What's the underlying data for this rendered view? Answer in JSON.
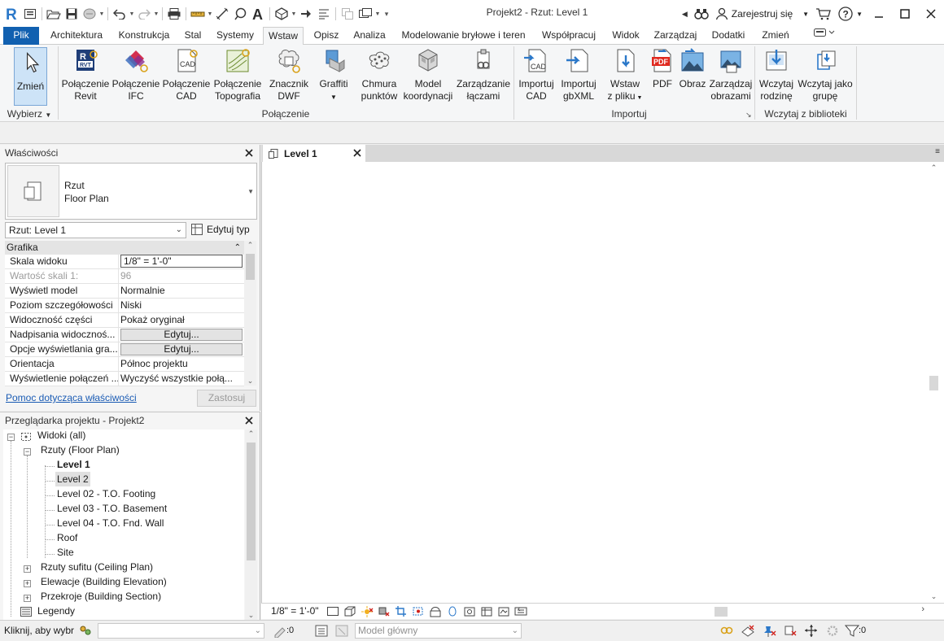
{
  "titlebar": {
    "window_title": "Projekt2 - Rzut: Level 1",
    "sign_in": "Zarejestruj się"
  },
  "tabs": [
    "Plik",
    "Architektura",
    "Konstrukcja",
    "Stal",
    "Systemy",
    "Wstaw",
    "Opisz",
    "Analiza",
    "Modelowanie bryłowe i teren",
    "Współpracuj",
    "Widok",
    "Zarządzaj",
    "Dodatki",
    "Zmień"
  ],
  "active_tab": "Wstaw",
  "ribbon": {
    "modify": {
      "label": "Zmień",
      "panel": "Wybierz"
    },
    "link_panel_label": "Połączenie",
    "link_buttons": [
      {
        "l1": "Połączenie",
        "l2": "Revit",
        "icon": "link-revit-icon"
      },
      {
        "l1": "Połączenie",
        "l2": "IFC",
        "icon": "link-ifc-icon"
      },
      {
        "l1": "Połączenie",
        "l2": "CAD",
        "icon": "link-cad-icon"
      },
      {
        "l1": "Połączenie",
        "l2": "Topografia",
        "icon": "link-topography-icon"
      },
      {
        "l1": "Znacznik",
        "l2": "DWF",
        "icon": "dwf-markup-icon"
      },
      {
        "l1": "Graffiti",
        "l2": "",
        "icon": "decal-icon"
      },
      {
        "l1": "Chmura",
        "l2": "punktów",
        "icon": "point-cloud-icon"
      },
      {
        "l1": "Model",
        "l2": "koordynacji",
        "icon": "coordination-model-icon"
      },
      {
        "l1": "Zarządzanie",
        "l2": "łączami",
        "icon": "manage-links-icon"
      }
    ],
    "import_panel_label": "Importuj",
    "import_buttons": [
      {
        "l1": "Importuj",
        "l2": "CAD",
        "icon": "import-cad-icon"
      },
      {
        "l1": "Importuj",
        "l2": "gbXML",
        "icon": "import-gbxml-icon"
      },
      {
        "l1": "Wstaw",
        "l2": "z pliku",
        "icon": "insert-from-file-icon"
      },
      {
        "l1": "PDF",
        "l2": "",
        "icon": "pdf-icon"
      },
      {
        "l1": "Obraz",
        "l2": "",
        "icon": "image-icon"
      },
      {
        "l1": "Zarządzaj",
        "l2": "obrazami",
        "icon": "manage-images-icon"
      }
    ],
    "library_panel_label": "Wczytaj z biblioteki",
    "library_buttons": [
      {
        "l1": "Wczytaj",
        "l2": "rodzinę",
        "icon": "load-family-icon"
      },
      {
        "l1": "Wczytaj jako",
        "l2": "grupę",
        "icon": "load-group-icon"
      }
    ]
  },
  "properties": {
    "title": "Właściwości",
    "type_line1": "Rzut",
    "type_line2": "Floor Plan",
    "selector_value": "Rzut: Level 1",
    "edit_type": "Edytuj typ",
    "group": "Grafika",
    "rows": [
      {
        "name": "Skala widoku",
        "value": "1/8\" = 1'-0\"",
        "kind": "input"
      },
      {
        "name": "Wartość skali    1:",
        "value": "96",
        "kind": "dim"
      },
      {
        "name": "Wyświetl model",
        "value": "Normalnie",
        "kind": "text"
      },
      {
        "name": "Poziom szczegółowości",
        "value": "Niski",
        "kind": "text"
      },
      {
        "name": "Widoczność części",
        "value": "Pokaż oryginał",
        "kind": "text"
      },
      {
        "name": "Nadpisania widocznoś...",
        "value": "Edytuj...",
        "kind": "button"
      },
      {
        "name": "Opcje wyświetlania gra...",
        "value": "Edytuj...",
        "kind": "button"
      },
      {
        "name": "Orientacja",
        "value": "Północ projektu",
        "kind": "text"
      },
      {
        "name": "Wyświetlenie połączeń ...",
        "value": "Wyczyść wszystkie połą...",
        "kind": "text"
      }
    ],
    "help_link": "Pomoc dotycząca właściwości",
    "apply": "Zastosuj"
  },
  "browser": {
    "title": "Przeglądarka projektu - Projekt2",
    "views_root": "Widoki (all)",
    "floor_plans": "Rzuty (Floor Plan)",
    "levels": [
      "Level 1",
      "Level 2",
      "Level 02 - T.O. Footing",
      "Level 03 - T.O. Basement",
      "Level 04 - T.O. Fnd. Wall",
      "Roof",
      "Site"
    ],
    "ceiling_plans": "Rzuty sufitu (Ceiling Plan)",
    "elevations": "Elewacje (Building Elevation)",
    "sections": "Przekroje (Building Section)",
    "legends": "Legendy"
  },
  "view": {
    "tab_label": "Level 1",
    "scale": "1/8\" = 1'-0\""
  },
  "status": {
    "prompt": "Kliknij, aby wybr",
    "selection_count": ":0",
    "workset": "Model główny",
    "filter_count": ":0"
  },
  "colors": {
    "file_tab": "#1160b0",
    "accent": "#2b78c9",
    "link": "#1a5bb4"
  }
}
